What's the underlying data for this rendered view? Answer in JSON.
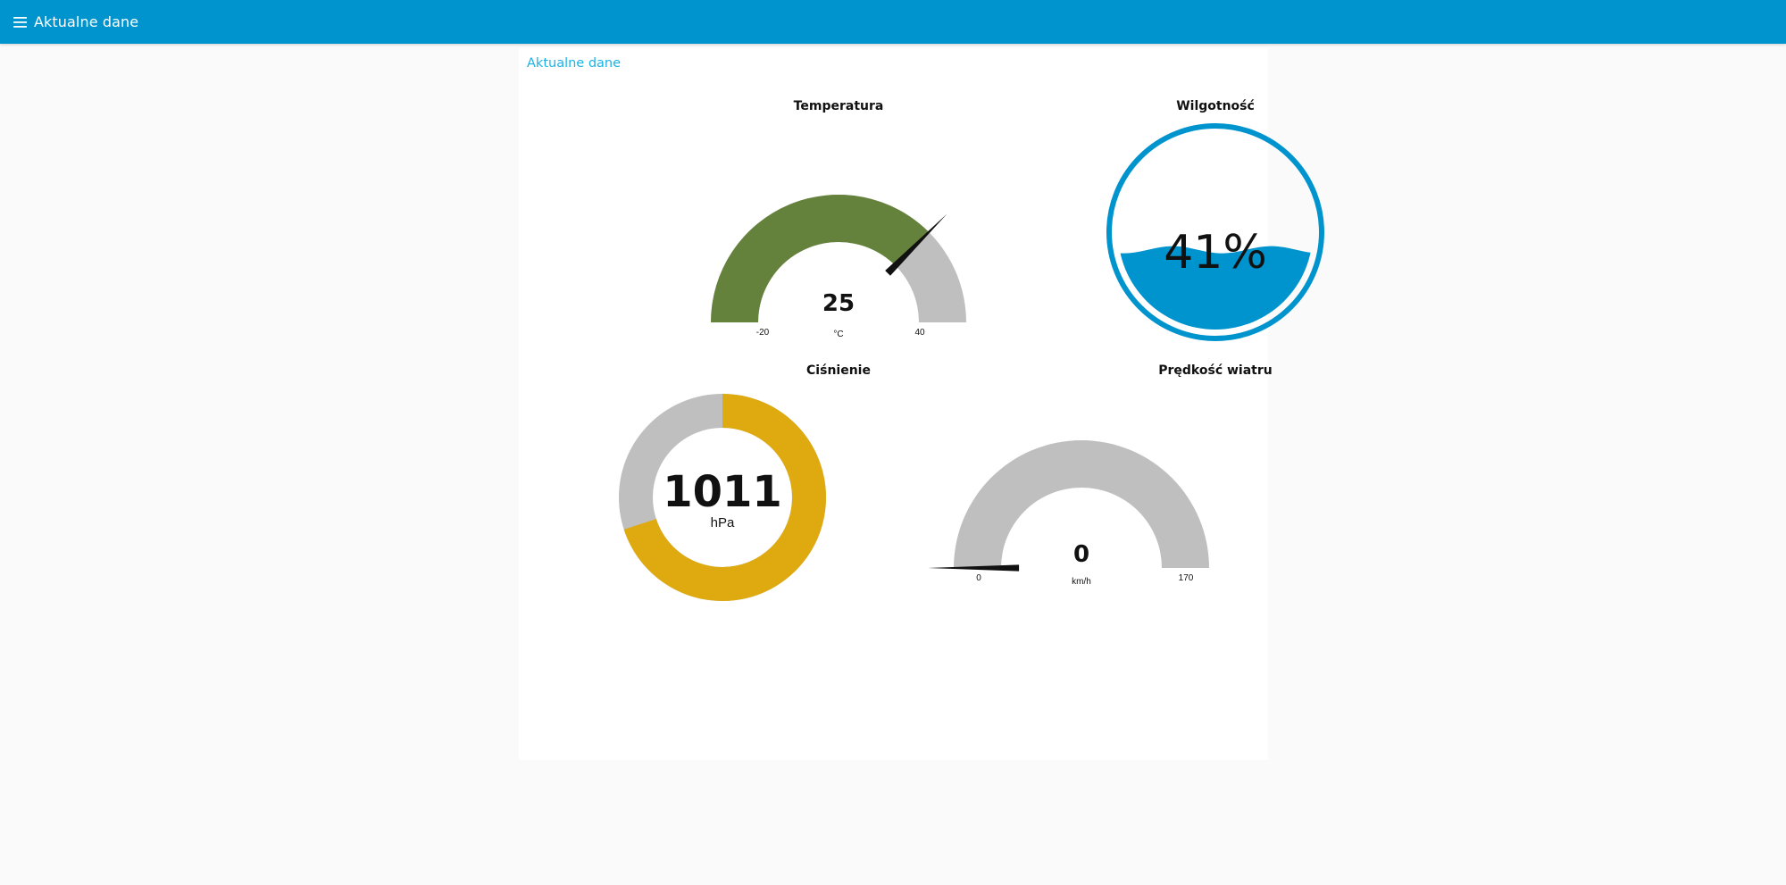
{
  "toolbar": {
    "title": "Aktualne dane",
    "background": "#0094ce"
  },
  "group": {
    "title": "Aktualne dane",
    "title_color": "#1bb3e6"
  },
  "widgets": {
    "temperature": {
      "label": "Temperatura",
      "value": 25,
      "value_text": "25",
      "unit": "°C",
      "min": -20,
      "max": 40,
      "min_text": "-20",
      "max_text": "40",
      "fill_color": "#65823c",
      "track_color": "#bfbfbf"
    },
    "humidity": {
      "label": "Wilgotność",
      "value": 41,
      "value_text": "41%",
      "fill_color": "#0094ce"
    },
    "pressure": {
      "label": "Ciśnienie",
      "value": 1011,
      "value_text": "1011",
      "unit": "hPa",
      "fill_fraction": 0.7,
      "fill_color": "#deaa10",
      "track_color": "#bfbfbf"
    },
    "wind": {
      "label": "Prędkość wiatru",
      "value": 0,
      "value_text": "0",
      "unit": "km/h",
      "min": 0,
      "max": 170,
      "min_text": "0",
      "max_text": "170",
      "track_color": "#bfbfbf"
    }
  }
}
